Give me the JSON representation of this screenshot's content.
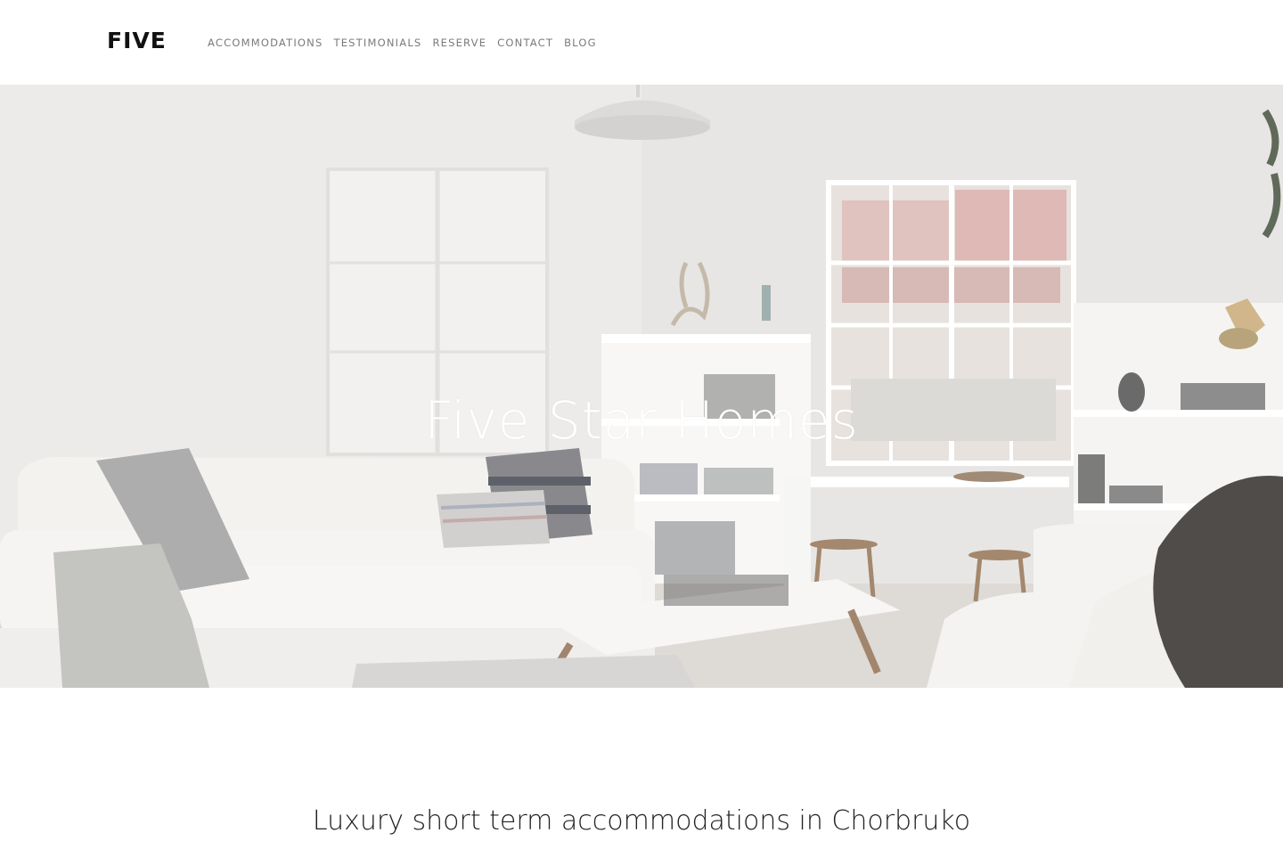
{
  "brand": {
    "logo_text": "FIVE"
  },
  "nav": {
    "items": [
      {
        "label": "ACCOMMODATIONS"
      },
      {
        "label": "TESTIMONIALS"
      },
      {
        "label": "RESERVE"
      },
      {
        "label": "CONTACT"
      },
      {
        "label": "BLOG"
      }
    ]
  },
  "hero": {
    "title": "Five Star Homes",
    "image_subject": "bright white living room with sofa, shelves and windows"
  },
  "intro": {
    "tagline": "Luxury short term accommodations in Chorbruko"
  },
  "colors": {
    "logo": "#111111",
    "nav_text": "#7a7a7a",
    "hero_title": "#ffffff",
    "tagline": "#222222",
    "page_background": "#ffffff"
  }
}
